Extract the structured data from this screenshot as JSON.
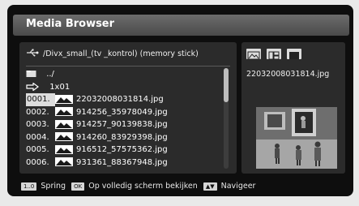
{
  "window": {
    "title": "Media Browser"
  },
  "path": {
    "text": "/Divx_small_(tv _kontrol) (memory stick)"
  },
  "list": {
    "up_label": "../",
    "folder_label": "1x01",
    "files": [
      {
        "num": "0001.",
        "name": "22032008031814.jpg"
      },
      {
        "num": "0002.",
        "name": "914256_35978049.jpg"
      },
      {
        "num": "0003.",
        "name": "914257_90139838.jpg"
      },
      {
        "num": "0004.",
        "name": "914260_83929398.jpg"
      },
      {
        "num": "0005.",
        "name": "916512_57575362.jpg"
      },
      {
        "num": "0006.",
        "name": "931361_88367948.jpg"
      }
    ],
    "selected_index": 0
  },
  "preview": {
    "filename": "22032008031814.jpg"
  },
  "footer": {
    "key1": "1..0",
    "label1": "Spring",
    "key2": "OK",
    "label2": "Op volledig scherm bekijken",
    "key3": "▲▼",
    "label3": "Navigeer"
  },
  "colors": {
    "panel": "#0e0e0e",
    "pane": "#2b2b2b",
    "title_bar": "#5b5b5b",
    "text": "#ffffff"
  }
}
